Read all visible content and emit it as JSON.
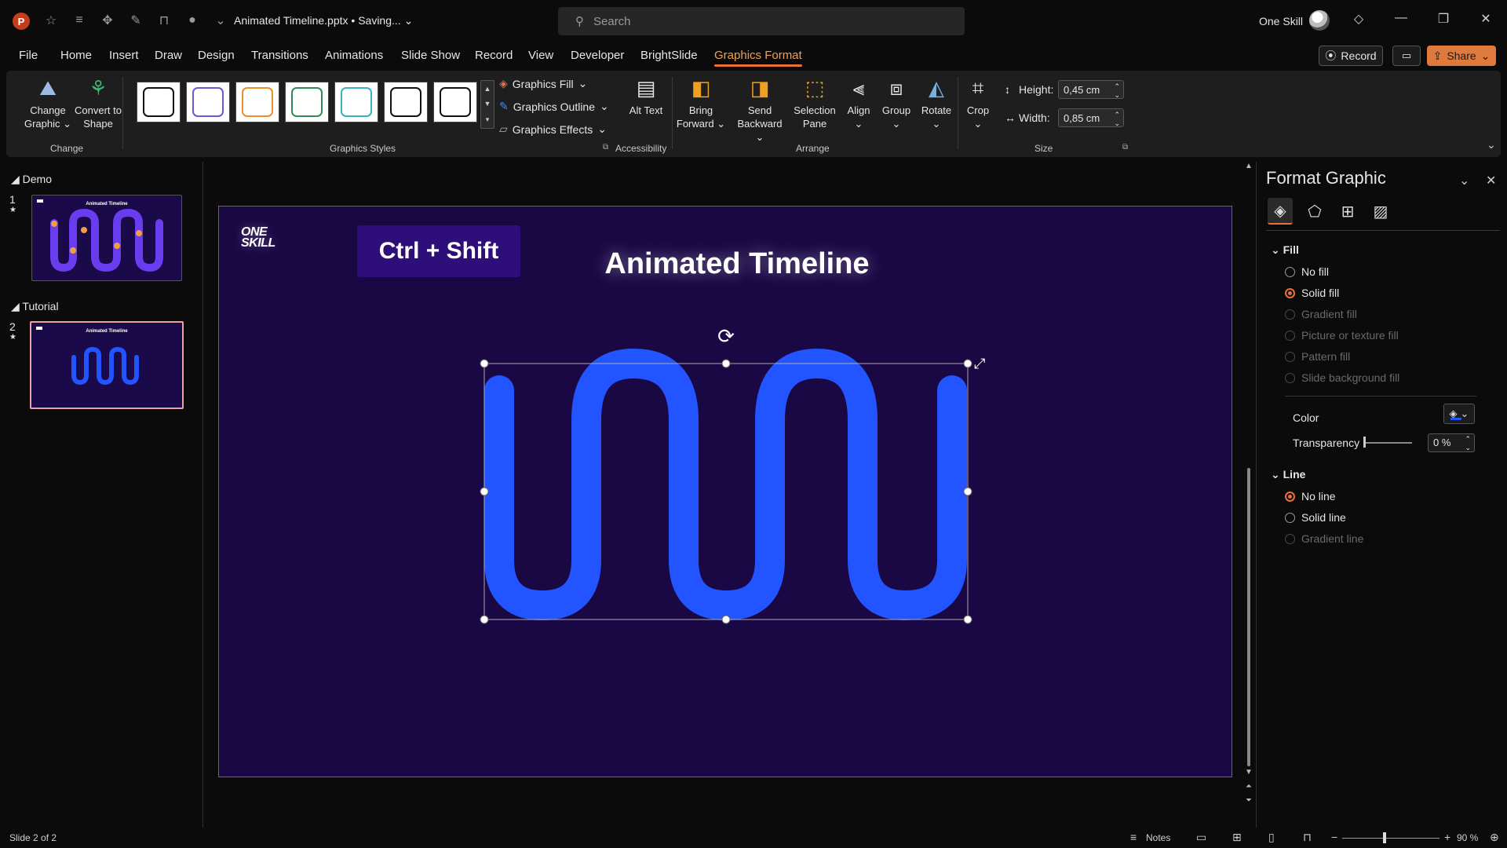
{
  "titlebar": {
    "app_icon": "P",
    "doc_title": "Animated Timeline.pptx • Saving...",
    "search_placeholder": "Search",
    "user_name": "One Skill",
    "qat_icons": [
      "autosave-icon",
      "undo-icon",
      "touch-mode-icon",
      "pen-icon",
      "presenter-icon",
      "redo-icon",
      "customize-icon"
    ]
  },
  "menu": {
    "tabs": [
      "File",
      "Home",
      "Insert",
      "Draw",
      "Design",
      "Transitions",
      "Animations",
      "Slide Show",
      "Record",
      "View",
      "Developer",
      "BrightSlide",
      "Graphics Format"
    ],
    "active": "Graphics Format",
    "record_label": "Record",
    "share_label": "Share"
  },
  "ribbon": {
    "change_graphic": "Change Graphic",
    "convert_to_shape": "Convert to Shape",
    "group_change": "Change",
    "group_graphics_styles": "Graphics Styles",
    "graphics_fill": "Graphics Fill",
    "graphics_outline": "Graphics Outline",
    "graphics_effects": "Graphics Effects",
    "alt_text": "Alt Text",
    "group_accessibility": "Accessibility",
    "bring_forward": "Bring Forward",
    "send_backward": "Send Backward",
    "selection_pane": "Selection Pane",
    "align": "Align",
    "group": "Group",
    "rotate": "Rotate",
    "group_arrange": "Arrange",
    "crop": "Crop",
    "height_label": "Height:",
    "height_value": "0,45 cm",
    "width_label": "Width:",
    "width_value": "0,85 cm",
    "group_size": "Size",
    "style_colors": [
      "#111111",
      "#6a5acd",
      "#e8902a",
      "#2e8b57",
      "#3ab0c0",
      "#111111",
      "#111111"
    ]
  },
  "thumbnails": {
    "sections": [
      {
        "name": "Demo",
        "slides": [
          {
            "number": "1",
            "title": "Animated Timeline"
          }
        ]
      },
      {
        "name": "Tutorial",
        "slides": [
          {
            "number": "2",
            "title": "Animated Timeline"
          }
        ]
      }
    ],
    "star_marker": "★"
  },
  "slide": {
    "logo_text": "ONE SKILL",
    "logo_line1": "ONE",
    "logo_line2": "SKILL",
    "shortcut_label": "Ctrl + Shift",
    "title": "Animated Timeline",
    "background_color": "#1a0845",
    "wave_color": "#2255ff"
  },
  "format_pane": {
    "title": "Format Graphic",
    "tabs": [
      "fill-line-icon",
      "effects-icon",
      "size-properties-icon",
      "picture-icon"
    ],
    "fill_section": "Fill",
    "fill_options": [
      {
        "label": "No fill",
        "checked": false,
        "disabled": false
      },
      {
        "label": "Solid fill",
        "checked": true,
        "disabled": false
      },
      {
        "label": "Gradient fill",
        "checked": false,
        "disabled": true
      },
      {
        "label": "Picture or texture fill",
        "checked": false,
        "disabled": true
      },
      {
        "label": "Pattern fill",
        "checked": false,
        "disabled": true
      },
      {
        "label": "Slide background fill",
        "checked": false,
        "disabled": true
      }
    ],
    "color_label": "Color",
    "transparency_label": "Transparency",
    "transparency_value": "0 %",
    "line_section": "Line",
    "line_options": [
      {
        "label": "No line",
        "checked": true,
        "disabled": false
      },
      {
        "label": "Solid line",
        "checked": false,
        "disabled": false
      },
      {
        "label": "Gradient line",
        "checked": false,
        "disabled": true
      }
    ],
    "accent_color": "#e8703a"
  },
  "statusbar": {
    "slide_info": "Slide 2 of 2",
    "notes_label": "Notes",
    "zoom": "90 %"
  }
}
